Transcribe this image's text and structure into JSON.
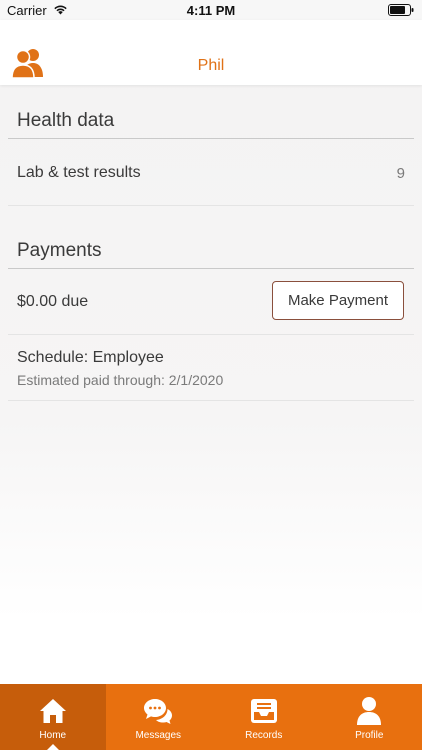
{
  "status_bar": {
    "carrier": "Carrier",
    "time": "4:11 PM",
    "wifi_icon": "wifi-icon",
    "battery_icon": "battery-icon"
  },
  "header": {
    "title": "Phil",
    "profile_icon": "people-icon",
    "accent_color": "#e07217"
  },
  "health_data": {
    "title": "Health data",
    "items": [
      {
        "label": "Lab & test results",
        "count": "9"
      }
    ]
  },
  "payments": {
    "title": "Payments",
    "due": "$0.00 due",
    "button_label": "Make Payment",
    "schedule": "Schedule: Employee",
    "paid_through": "Estimated paid through: 2/1/2020"
  },
  "tab_bar": {
    "color": "#e8700f",
    "active_color": "#c65d0b",
    "tabs": [
      {
        "label": "Home",
        "icon": "home-icon",
        "active": true
      },
      {
        "label": "Messages",
        "icon": "chat-icon",
        "active": false
      },
      {
        "label": "Records",
        "icon": "inbox-icon",
        "active": false
      },
      {
        "label": "Profile",
        "icon": "person-icon",
        "active": false
      }
    ]
  }
}
